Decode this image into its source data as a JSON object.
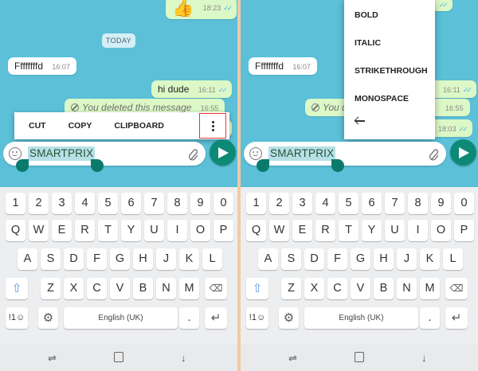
{
  "chat": {
    "date_pill": "TODAY",
    "thumbs_emoji": "👍",
    "thumbs_time": "18:23",
    "msg_in_text": "Ffffffffd",
    "msg_in_time": "16:07",
    "msg_out_text": "hi dude",
    "msg_out_time": "16:11",
    "deleted_text": "You deleted this message",
    "deleted_time": "16:55",
    "last_time": "18:03",
    "right_deleted_partial": "You d"
  },
  "context_menu": {
    "cut": "CUT",
    "copy": "COPY",
    "clipboard": "CLIPBOARD"
  },
  "overflow_menu": {
    "items": [
      "BOLD",
      "ITALIC",
      "STRIKETHROUGH",
      "MONOSPACE"
    ]
  },
  "input": {
    "selected_text": "SMARTPRIX"
  },
  "keyboard": {
    "row1": [
      "1",
      "2",
      "3",
      "4",
      "5",
      "6",
      "7",
      "8",
      "9",
      "0"
    ],
    "row2": [
      "Q",
      "W",
      "E",
      "R",
      "T",
      "Y",
      "U",
      "I",
      "O",
      "P"
    ],
    "row3": [
      "A",
      "S",
      "D",
      "F",
      "G",
      "H",
      "J",
      "K",
      "L"
    ],
    "row4": [
      "Z",
      "X",
      "C",
      "V",
      "B",
      "N",
      "M"
    ],
    "symbols_key": "!1☺",
    "space_label": "English (UK)",
    "period_key": ".",
    "settings_superscript": "⁂"
  },
  "colors": {
    "chat_bg": "#5bc0d8",
    "outgoing_bubble": "#dcf8c6",
    "accent": "#0c8a76",
    "read_ticks": "#4fb6ec",
    "highlight_frame": "#e33333"
  }
}
